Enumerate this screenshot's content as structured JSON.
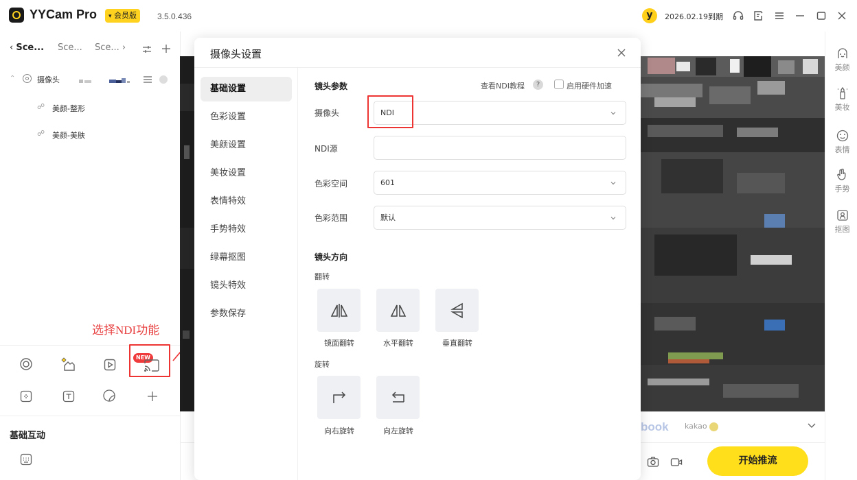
{
  "app": {
    "name": "YYCam Pro",
    "vip_badge": "会员版",
    "version": "3.5.0.436",
    "avatar_letter": "y",
    "expiry": "2026.02.19到期"
  },
  "scene_tabs": [
    "Sce...",
    "Sce...",
    "Sce..."
  ],
  "source_tree": {
    "camera_label": "摄像头",
    "children": [
      "美颜-整形",
      "美颜-美肤"
    ]
  },
  "basic_interaction_title": "基础互动",
  "new_badge": "NEW",
  "annotation": {
    "note": "选择NDI功能"
  },
  "dialog": {
    "title": "摄像头设置",
    "nav": [
      "基础设置",
      "色彩设置",
      "美颜设置",
      "美妆设置",
      "表情特效",
      "手势特效",
      "绿幕抠图",
      "镜头特效",
      "参数保存"
    ],
    "active_nav": 0,
    "lens_params_title": "镜头参数",
    "ndi_tutorial": "查看NDI教程",
    "help_mark": "?",
    "hw_accel": "启用硬件加速",
    "fields": [
      {
        "label": "摄像头",
        "value": "NDI",
        "dropdown": true
      },
      {
        "label": "NDI源",
        "value": "",
        "dropdown": false
      },
      {
        "label": "色彩空间",
        "value": "601",
        "dropdown": true
      },
      {
        "label": "色彩范围",
        "value": "默认",
        "dropdown": true
      }
    ],
    "direction_title": "镜头方向",
    "flip_title": "翻转",
    "flip_buttons": [
      "镜面翻转",
      "水平翻转",
      "垂直翻转"
    ],
    "rotate_title": "旋转",
    "rotate_buttons": [
      "向右旋转",
      "向左旋转"
    ]
  },
  "right_sidebar": [
    "美颜",
    "美妆",
    "表情",
    "手势",
    "抠图"
  ],
  "platforms": {
    "facebook_fragment": "book",
    "kakao": "kakao"
  },
  "start_button": "开始推流",
  "colors": {
    "accent_yellow": "#ffdf1c",
    "annotation_red": "#e33333"
  }
}
